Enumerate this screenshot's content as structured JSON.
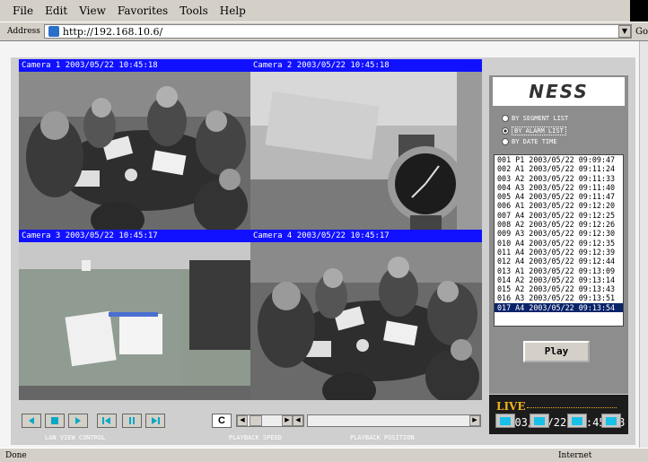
{
  "menu": [
    "File",
    "Edit",
    "View",
    "Favorites",
    "Tools",
    "Help"
  ],
  "address": {
    "label": "Address",
    "url": "http://192.168.10.6/",
    "go": "Go"
  },
  "cameras": [
    {
      "title": "Camera 1 2003/05/22 10:45:18"
    },
    {
      "title": "Camera 2 2003/05/22 10:45:18"
    },
    {
      "title": "Camera 3 2003/05/22 10:45:17"
    },
    {
      "title": "Camera 4 2003/05/22 10:45:17"
    }
  ],
  "logo": "NESS",
  "search_modes": [
    {
      "label": "BY SEGMENT LIST",
      "selected": false
    },
    {
      "label": "BY ALARM LIST",
      "selected": true
    },
    {
      "label": "BY DATE TIME",
      "selected": false
    }
  ],
  "events": [
    "001 P1 2003/05/22 09:09:47",
    "002 A1 2003/05/22 09:11:24",
    "003 A2 2003/05/22 09:11:33",
    "004 A3 2003/05/22 09:11:40",
    "005 A4 2003/05/22 09:11:47",
    "006 A1 2003/05/22 09:12:20",
    "007 A4 2003/05/22 09:12:25",
    "008 A2 2003/05/22 09:12:26",
    "009 A3 2003/05/22 09:12:30",
    "010 A4 2003/05/22 09:12:35",
    "011 A4 2003/05/22 09:12:39",
    "012 A4 2003/05/22 09:12:44",
    "013 A1 2003/05/22 09:13:09",
    "014 A2 2003/05/22 09:13:14",
    "015 A2 2003/05/22 09:13:43",
    "016 A3 2003/05/22 09:13:51",
    "017 A4 2003/05/22 09:13:54"
  ],
  "play_label": "Play",
  "live": {
    "label": "LIVE",
    "datetime": "2003/05/22  10:45:18"
  },
  "labels": {
    "lan_view": "LAN VIEW CONTROL",
    "playback_speed": "PLAYBACK SPEED",
    "playback_position": "PLAYBACK POSITION",
    "c_button": "C"
  },
  "status": {
    "left": "Done",
    "right": "Internet"
  }
}
